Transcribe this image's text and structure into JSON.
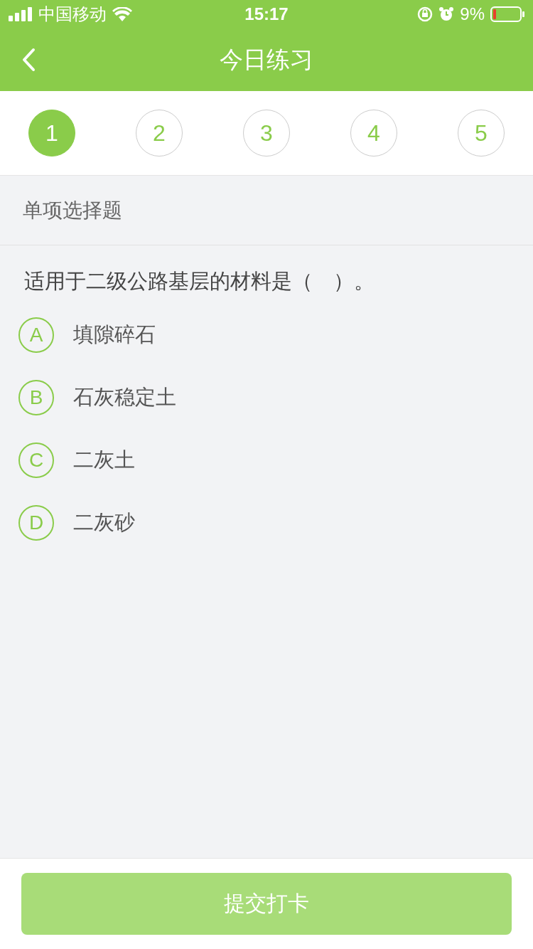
{
  "status_bar": {
    "carrier": "中国移动",
    "time": "15:17",
    "battery_percent": "9%"
  },
  "nav": {
    "title": "今日练习"
  },
  "steps": [
    {
      "label": "1",
      "selected": true
    },
    {
      "label": "2",
      "selected": false
    },
    {
      "label": "3",
      "selected": false
    },
    {
      "label": "4",
      "selected": false
    },
    {
      "label": "5",
      "selected": false
    }
  ],
  "section_title": "单项选择题",
  "question": "适用于二级公路基层的材料是（　）。",
  "options": [
    {
      "letter": "A",
      "text": "填隙碎石",
      "selected": false
    },
    {
      "letter": "B",
      "text": "石灰稳定土",
      "selected": false
    },
    {
      "letter": "C",
      "text": "二灰土",
      "selected": false
    },
    {
      "letter": "D",
      "text": "二灰砂",
      "selected": false
    }
  ],
  "submit": {
    "label": "提交打卡",
    "disabled": true
  }
}
